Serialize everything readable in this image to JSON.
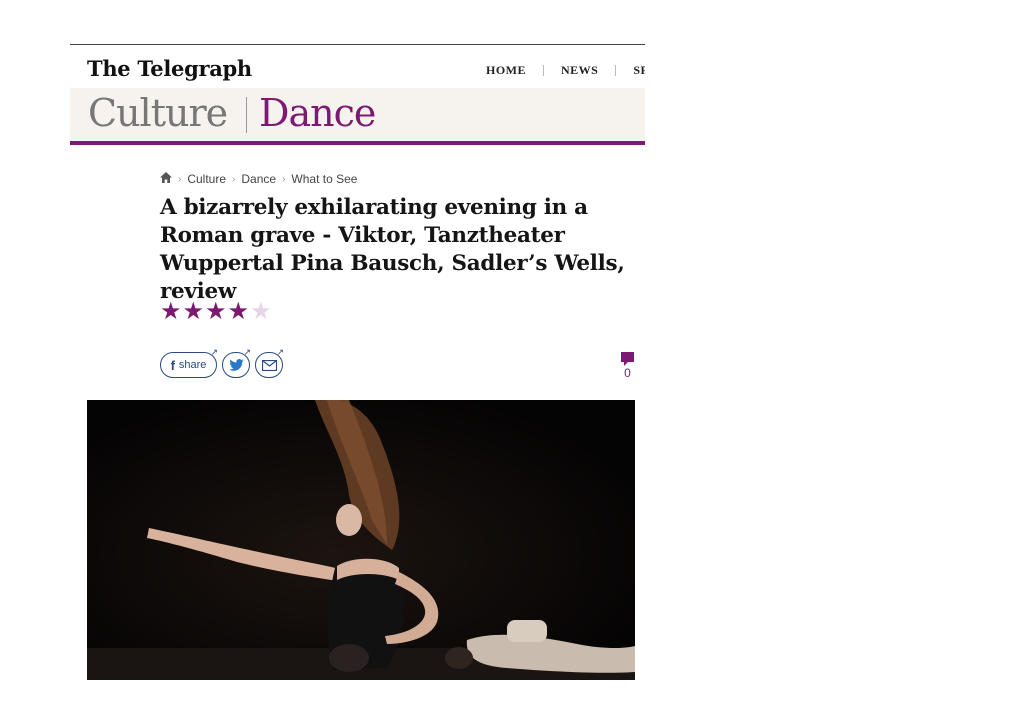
{
  "masthead": {
    "logo": "The Telegraph",
    "nav": [
      "HOME",
      "NEWS",
      "SP"
    ]
  },
  "section": {
    "primary": "Culture",
    "secondary": "Dance"
  },
  "breadcrumb": {
    "items": [
      "Culture",
      "Dance",
      "What to See"
    ]
  },
  "article": {
    "headline": "A bizarrely exhilarating evening in a Roman grave - Viktor, Tanztheater Wuppertal Pina Bausch, Sadler’s Wells, review",
    "rating": 4,
    "rating_max": 5
  },
  "share": {
    "facebook_label": "share"
  },
  "comments": {
    "count": "0"
  },
  "colors": {
    "accent": "#7c1a72",
    "section_bg": "#f6f3ee",
    "share_blue": "#2a4a80"
  },
  "icons": [
    "home-icon",
    "facebook-icon",
    "twitter-icon",
    "email-icon",
    "comment-icon"
  ]
}
